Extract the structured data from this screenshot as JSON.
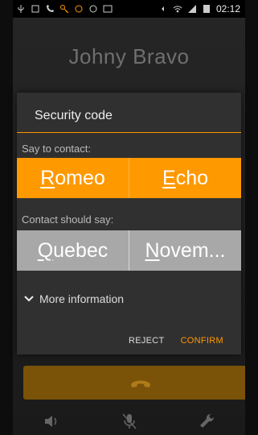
{
  "status_bar": {
    "time": "02:12",
    "battery_icon": "battery-icon",
    "signal_icon": "signal-icon"
  },
  "caller": {
    "name": "Johny Bravo"
  },
  "dialog": {
    "title": "Security code",
    "say_label": "Say to contact:",
    "say_words": [
      {
        "first": "R",
        "rest": "omeo"
      },
      {
        "first": "E",
        "rest": "cho"
      }
    ],
    "hear_label": "Contact should say:",
    "hear_words": [
      {
        "first": "Q",
        "rest": "uebec"
      },
      {
        "first": "N",
        "rest": "ovem..."
      }
    ],
    "more_info": "More information",
    "reject": "REJECT",
    "confirm": "CONFIRM"
  },
  "controls": {
    "hangup_icon": "phone-hangup-icon",
    "speaker_icon": "speaker-icon",
    "mute_icon": "mic-muted-icon",
    "settings_icon": "wrench-icon"
  },
  "colors": {
    "accent": "#ff9900",
    "grey_row": "#a8a8a8",
    "hangup_bg": "#7a5208"
  }
}
